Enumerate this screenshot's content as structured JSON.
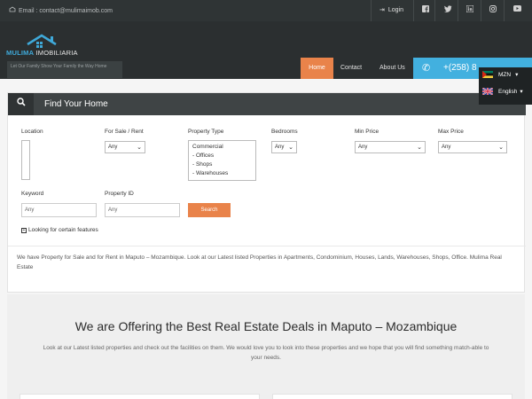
{
  "topbar": {
    "email": "Email : contact@mulimaimob.com",
    "login": "Login",
    "social_icons": [
      "facebook-icon",
      "twitter-icon",
      "linkedin-icon",
      "instagram-icon"
    ]
  },
  "header": {
    "brand_first": "MULIMA",
    "brand_second": " IMOBILIARIA",
    "tagline": "Let Our Family Show Your Family the Way Home",
    "nav": {
      "home": "Home",
      "contact": "Contact",
      "about": "About Us"
    },
    "phone": "+(258) 8",
    "currency": "MZN",
    "language": "English"
  },
  "search": {
    "title": "Find Your Home",
    "location_label": "Location",
    "sale_label": "For Sale / Rent",
    "sale_value": "Any",
    "type_label": "Property Type",
    "types": [
      "Commercial",
      "- Offices",
      "- Shops",
      "- Warehouses"
    ],
    "bedrooms_label": "Bedrooms",
    "bedrooms_value": "Any",
    "min_label": "Min Price",
    "min_value": "Any",
    "max_label": "Max Price",
    "max_value": "Any",
    "keyword_label": "Keyword",
    "keyword_placeholder": "Any",
    "id_label": "Property ID",
    "id_placeholder": "Any",
    "search_button": "Search",
    "features_link": "Looking for certain features",
    "description": "We have Property for Sale and for Rent in Maputo – Mozambique. Look at our Latest listed Properties in Apartments, Condominium, Houses, Lands, Warehouses, Shops, Office. Mulima Real Estate"
  },
  "offer": {
    "heading": "We are Offering the Best Real Estate Deals in Maputo – Mozambique",
    "text": "Look at our Latest listed properties and check out the facilities on them. We would love you to look into these properties and we hope that you will find something match-able to your needs."
  },
  "colors": {
    "accent": "#e9834a",
    "blue": "#42b0df",
    "dark": "#2b2f30"
  }
}
